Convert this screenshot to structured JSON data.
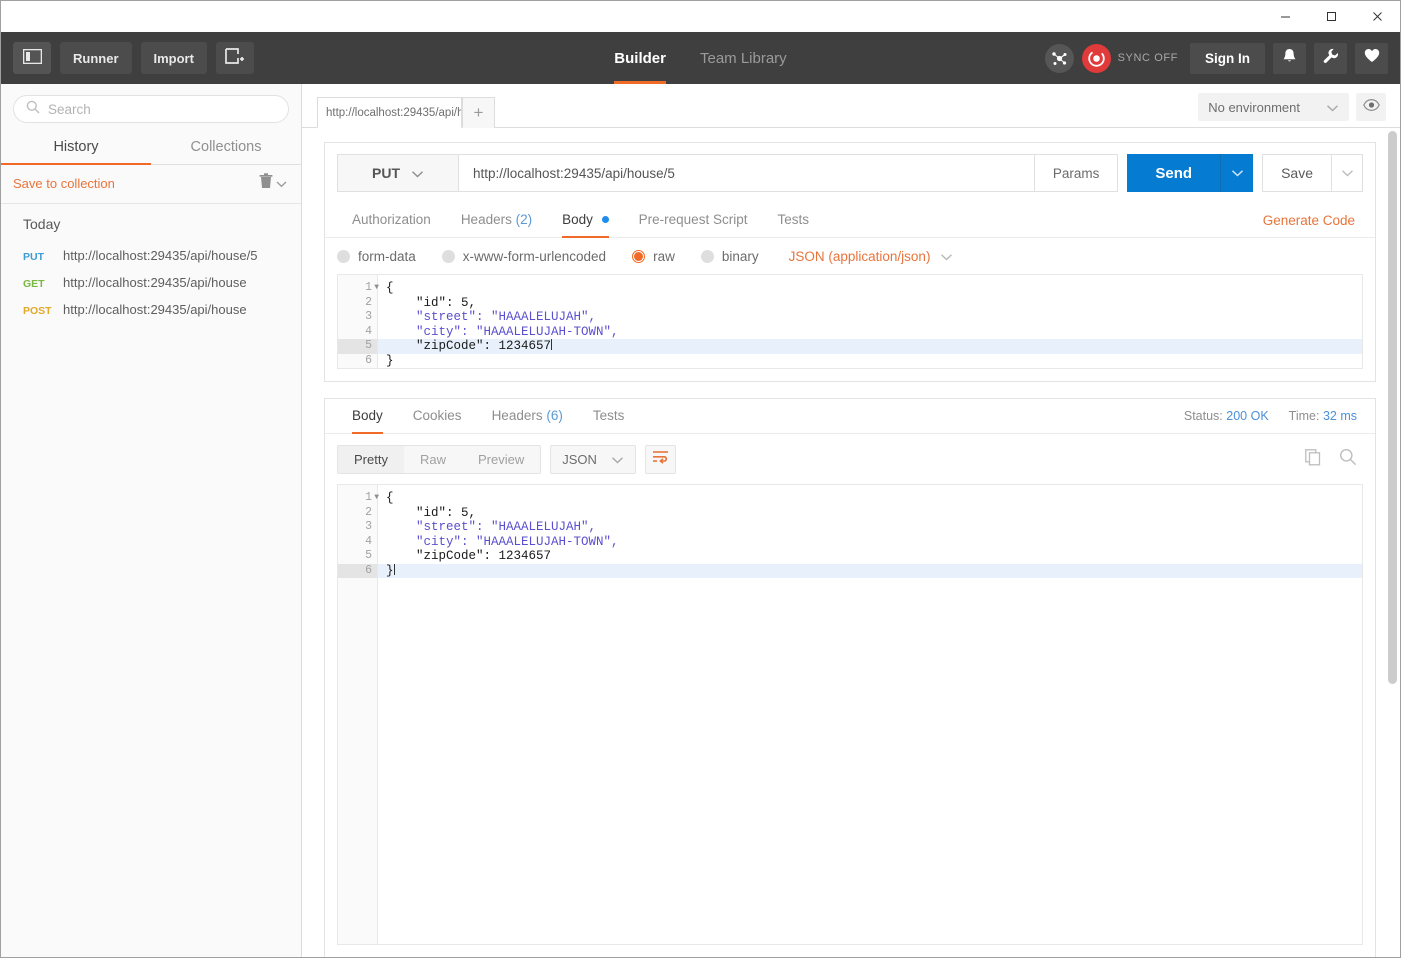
{
  "window": {
    "minimize": "—",
    "maximize": "□",
    "close": "✕"
  },
  "topbar": {
    "sidebar_toggle": "sidebar-toggle",
    "runner": "Runner",
    "import": "Import",
    "new_window": "new-window",
    "nav": [
      {
        "label": "Builder",
        "active": true
      },
      {
        "label": "Team Library",
        "active": false
      }
    ],
    "sync_label": "SYNC OFF",
    "sign_in": "Sign In",
    "icons": [
      "bell-icon",
      "wrench-icon",
      "heart-icon"
    ]
  },
  "sidebar": {
    "search": {
      "placeholder": "Search",
      "value": ""
    },
    "tabs": [
      {
        "label": "History",
        "active": true
      },
      {
        "label": "Collections",
        "active": false
      }
    ],
    "save_to_collection": "Save to collection",
    "day_label": "Today",
    "history": [
      {
        "method": "PUT",
        "url": "http://localhost:29435/api/house/5"
      },
      {
        "method": "GET",
        "url": "http://localhost:29435/api/house"
      },
      {
        "method": "POST",
        "url": "http://localhost:29435/api/house"
      }
    ]
  },
  "tabstrip": {
    "request_tab": "http://localhost:29435/api/h",
    "add_tab": "+",
    "environment": "No environment",
    "eye": "eye-icon"
  },
  "request": {
    "method": "PUT",
    "url": "http://localhost:29435/api/house/5",
    "params_label": "Params",
    "send_label": "Send",
    "save_label": "Save",
    "tabs": [
      {
        "label": "Authorization",
        "active": false,
        "count": "",
        "dot": false
      },
      {
        "label": "Headers",
        "active": false,
        "count": "(2)",
        "dot": false
      },
      {
        "label": "Body",
        "active": true,
        "count": "",
        "dot": true
      },
      {
        "label": "Pre-request Script",
        "active": false,
        "count": "",
        "dot": false
      },
      {
        "label": "Tests",
        "active": false,
        "count": "",
        "dot": false
      }
    ],
    "generate_code": "Generate Code",
    "body_types": [
      {
        "label": "form-data",
        "selected": false
      },
      {
        "label": "x-www-form-urlencoded",
        "selected": false
      },
      {
        "label": "raw",
        "selected": true
      },
      {
        "label": "binary",
        "selected": false
      }
    ],
    "content_type": "JSON (application/json)",
    "editor": {
      "highlight_line": 5,
      "lines": [
        {
          "n": 1,
          "fold": true,
          "text": "{"
        },
        {
          "n": 2,
          "fold": false,
          "text": "    \"id\": 5,"
        },
        {
          "n": 3,
          "fold": false,
          "text": "    \"street\": \"HAAALELUJAH\","
        },
        {
          "n": 4,
          "fold": false,
          "text": "    \"city\": \"HAAALELUJAH-TOWN\","
        },
        {
          "n": 5,
          "fold": false,
          "text": "    \"zipCode\": 1234657"
        },
        {
          "n": 6,
          "fold": false,
          "text": "}"
        }
      ]
    }
  },
  "response": {
    "tabs": [
      {
        "label": "Body",
        "active": true,
        "count": ""
      },
      {
        "label": "Cookies",
        "active": false,
        "count": ""
      },
      {
        "label": "Headers",
        "active": false,
        "count": "(6)"
      },
      {
        "label": "Tests",
        "active": false,
        "count": ""
      }
    ],
    "status_label": "Status:",
    "status_value": "200 OK",
    "time_label": "Time:",
    "time_value": "32 ms",
    "views": [
      {
        "label": "Pretty",
        "active": true
      },
      {
        "label": "Raw",
        "active": false
      },
      {
        "label": "Preview",
        "active": false
      }
    ],
    "format": "JSON",
    "wrap_icon": "word-wrap-icon",
    "copy_icon": "copy-icon",
    "search_icon": "search-icon",
    "editor": {
      "highlight_line": 6,
      "lines": [
        {
          "n": 1,
          "fold": true,
          "text": "{"
        },
        {
          "n": 2,
          "fold": false,
          "text": "    \"id\": 5,"
        },
        {
          "n": 3,
          "fold": false,
          "text": "    \"street\": \"HAAALELUJAH\","
        },
        {
          "n": 4,
          "fold": false,
          "text": "    \"city\": \"HAAALELUJAH-TOWN\","
        },
        {
          "n": 5,
          "fold": false,
          "text": "    \"zipCode\": 1234657"
        },
        {
          "n": 6,
          "fold": false,
          "text": "}"
        }
      ]
    }
  },
  "colors": {
    "accent_orange": "#f06a28",
    "send_blue": "#057bd2",
    "topbar_dark": "#3f3f3f",
    "status_blue": "#4a90d9"
  }
}
